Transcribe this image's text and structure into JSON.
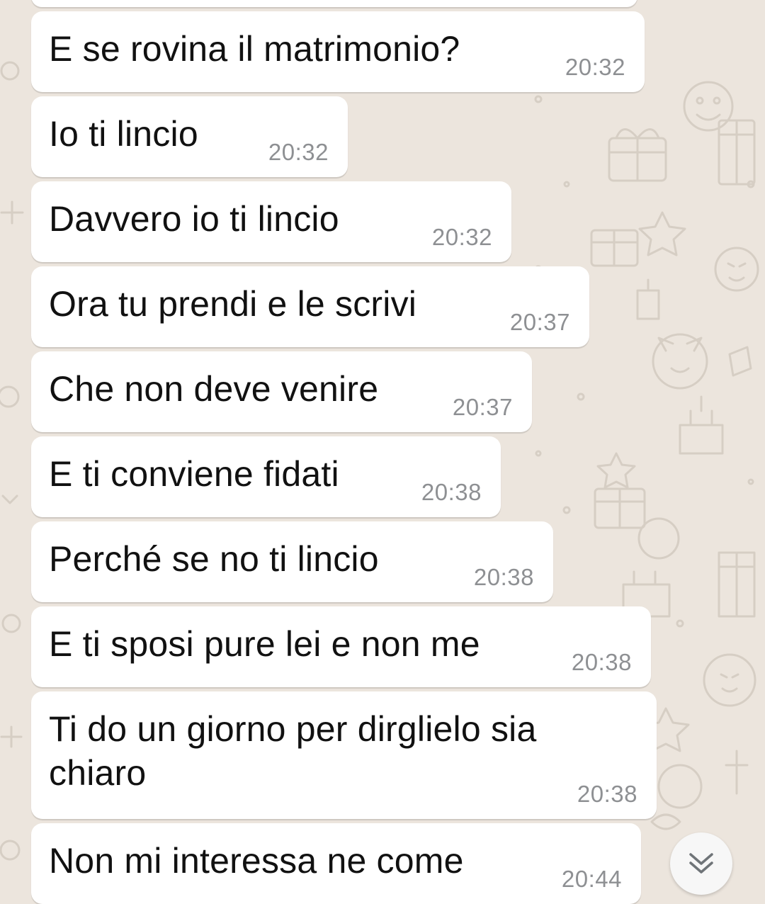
{
  "messages": [
    {
      "text": "E se rovina il matrimonio?",
      "time": "20:32"
    },
    {
      "text": "Io ti lincio",
      "time": "20:32"
    },
    {
      "text": "Davvero io ti lincio",
      "time": "20:32"
    },
    {
      "text": "Ora tu prendi e le scrivi",
      "time": "20:37"
    },
    {
      "text": "Che non deve venire",
      "time": "20:37"
    },
    {
      "text": "E ti conviene fidati",
      "time": "20:38"
    },
    {
      "text": "Perché se no ti lincio",
      "time": "20:38"
    },
    {
      "text": "E ti sposi pure lei e non me",
      "time": "20:38"
    },
    {
      "text": "Ti do un giorno per dirglielo sia\nchiaro",
      "time": "20:38"
    },
    {
      "text": "Non mi interessa ne come",
      "time": "20:44"
    }
  ],
  "icons": {
    "scroll_down": "double-chevron-down-icon"
  },
  "colors": {
    "wallpaper": "#ECE5DD",
    "bubble": "#FFFFFF",
    "text": "#111111",
    "timestamp": "#8E9093"
  }
}
